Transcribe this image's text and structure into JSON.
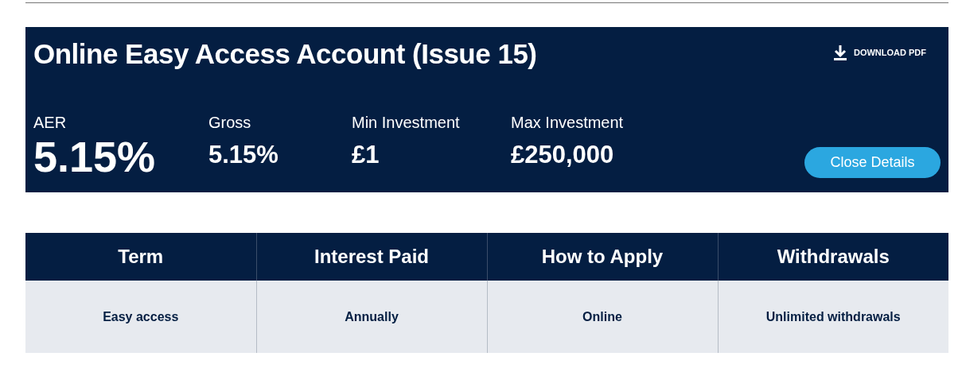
{
  "product": {
    "title": "Online Easy Access Account (Issue 15)",
    "download": "DOWNLOAD PDF",
    "close_button": "Close Details",
    "stats": [
      {
        "label": "AER",
        "value": "5.15%",
        "kind": "primary"
      },
      {
        "label": "Gross",
        "value": "5.15%",
        "kind": "secondary"
      },
      {
        "label": "Min Investment",
        "value": "£1",
        "kind": "secondary"
      },
      {
        "label": "Max Investment",
        "value": "£250,000",
        "kind": "secondary"
      }
    ]
  },
  "table": {
    "columns": [
      "Term",
      "Interest Paid",
      "How to Apply",
      "Withdrawals"
    ],
    "rows": [
      [
        "Easy access",
        "Annually",
        "Online",
        "Unlimited withdrawals"
      ]
    ]
  }
}
